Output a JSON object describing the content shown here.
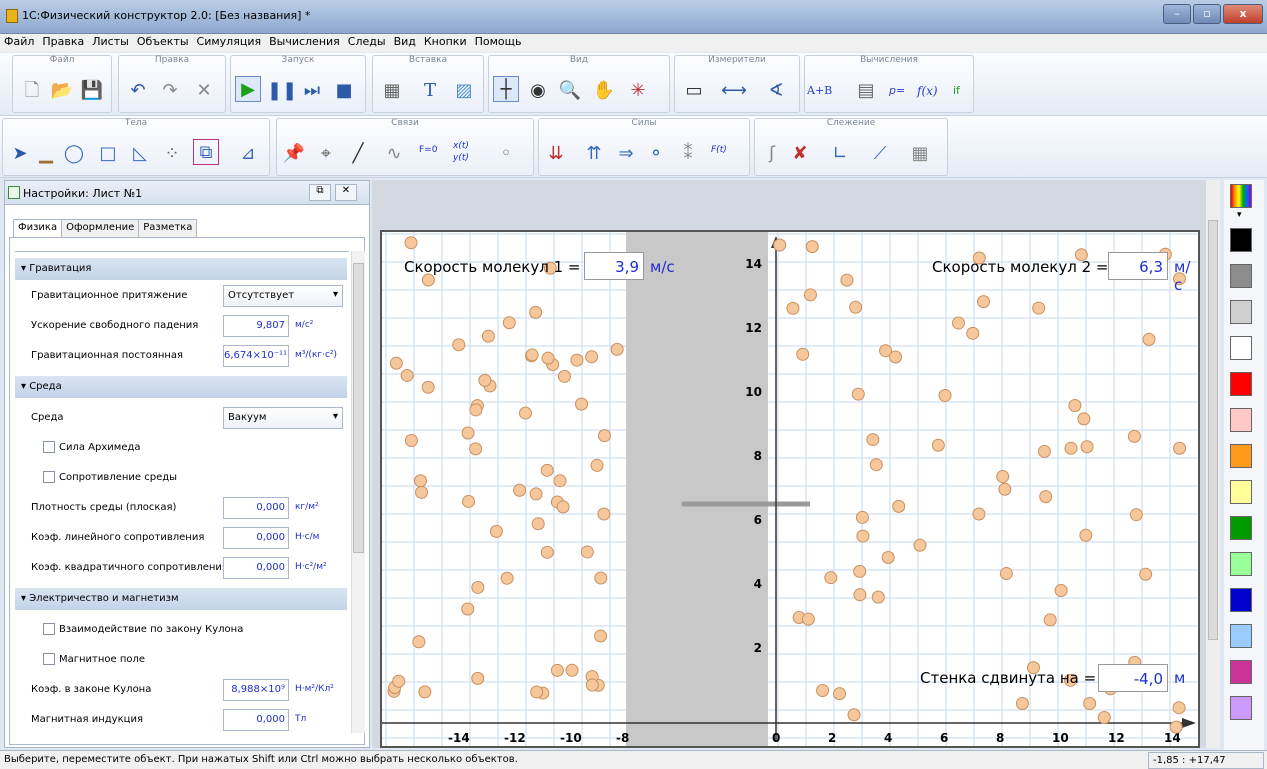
{
  "title": "1С:Физический конструктор 2.0: [Без названия] *",
  "menu": [
    "Файл",
    "Правка",
    "Листы",
    "Объекты",
    "Симуляция",
    "Вычисления",
    "Следы",
    "Вид",
    "Кнопки",
    "Помощь"
  ],
  "toolbar": {
    "groups_top": [
      "Файл",
      "Правка",
      "Запуск",
      "Вставка",
      "Вид",
      "Измерители",
      "Вычисления"
    ],
    "groups_bottom": [
      "Тела",
      "Связи",
      "Силы",
      "Слежение"
    ],
    "calc_items": [
      "A+B",
      "p=",
      "f(x)",
      "if"
    ],
    "ft": "F(t)",
    "xt": "x(t)",
    "yt": "y(t)",
    "f0": "F=0"
  },
  "panel": {
    "title": "Настройки: Лист №1",
    "tabs": [
      "Физика",
      "Оформление",
      "Разметка"
    ],
    "sections": {
      "gravity": "Гравитация",
      "medium": "Среда",
      "em": "Электричество и магнетизм"
    },
    "gravity_rows": [
      {
        "label": "Гравитационное притяжение",
        "select": "Отсутствует"
      },
      {
        "label": "Ускорение свободного падения",
        "value": "9,807",
        "unit": "м/с²"
      },
      {
        "label": "Гравитационная постоянная",
        "value": "6,674×10⁻¹¹",
        "unit": "м³/(кг·с²)"
      }
    ],
    "medium_rows": [
      {
        "label": "Среда",
        "select": "Вакуум"
      },
      {
        "label": "Сила Архимеда",
        "checkbox": true
      },
      {
        "label": "Сопротивление среды",
        "checkbox": true
      },
      {
        "label": "Плотность среды (плоская)",
        "value": "0,000",
        "unit": "кг/м²"
      },
      {
        "label": "Коэф. линейного сопротивления",
        "value": "0,000",
        "unit": "Н·с/м"
      },
      {
        "label": "Коэф. квадратичного сопротивления",
        "value": "0,000",
        "unit": "Н·с²/м²"
      }
    ],
    "em_rows": [
      {
        "label": "Взаимодействие по закону Кулона",
        "checkbox": true
      },
      {
        "label": "Магнитное поле",
        "checkbox": true
      },
      {
        "label": "Коэф. в законе Кулона",
        "value": "8,988×10⁹",
        "unit": "Н·м²/Кл²"
      },
      {
        "label": "Магнитная индукция",
        "value": "0,000",
        "unit": "Тл"
      }
    ]
  },
  "scene": {
    "speed1": {
      "label": "Скорость молекул 1 =",
      "value": "3,9",
      "unit": "м/с"
    },
    "speed2": {
      "label": "Скорость молекул 2 =",
      "value": "6,3",
      "unit": "м/с"
    },
    "wall": {
      "label": "Стенка сдвинута на =",
      "value": "-4,0",
      "unit": "м"
    },
    "x_ticks_left": [
      "-14",
      "-12",
      "-10",
      "-8"
    ],
    "x_ticks_right": [
      "0",
      "2",
      "4",
      "6",
      "8",
      "10",
      "12",
      "14"
    ],
    "y_ticks": [
      "2",
      "4",
      "6",
      "8",
      "10",
      "12",
      "14"
    ],
    "x_values_left": [
      -14,
      -12,
      -10,
      -8
    ],
    "x_values_right": [
      0,
      2,
      4,
      6,
      8,
      10,
      12,
      14
    ],
    "y_values": [
      2,
      4,
      6,
      8,
      10,
      12,
      14
    ],
    "molecule_color": "#f5c79a",
    "grid_color": "#c5d8f0"
  },
  "status": {
    "hint": "Выберите, переместите объект. При нажатых Shift или Ctrl можно выбрать несколько объектов.",
    "coords": "-1,85 : +17,47"
  },
  "palette": [
    "#ff7a00",
    "#000000",
    "#8c8c8c",
    "#cfcfcf",
    "#ffffff",
    "#ff0000",
    "#ffc8c8",
    "#ff9a1a",
    "#ffff99",
    "#009900",
    "#99ff99",
    "#0000cc",
    "#99ccff",
    "#cc3399",
    "#cc99ff"
  ]
}
